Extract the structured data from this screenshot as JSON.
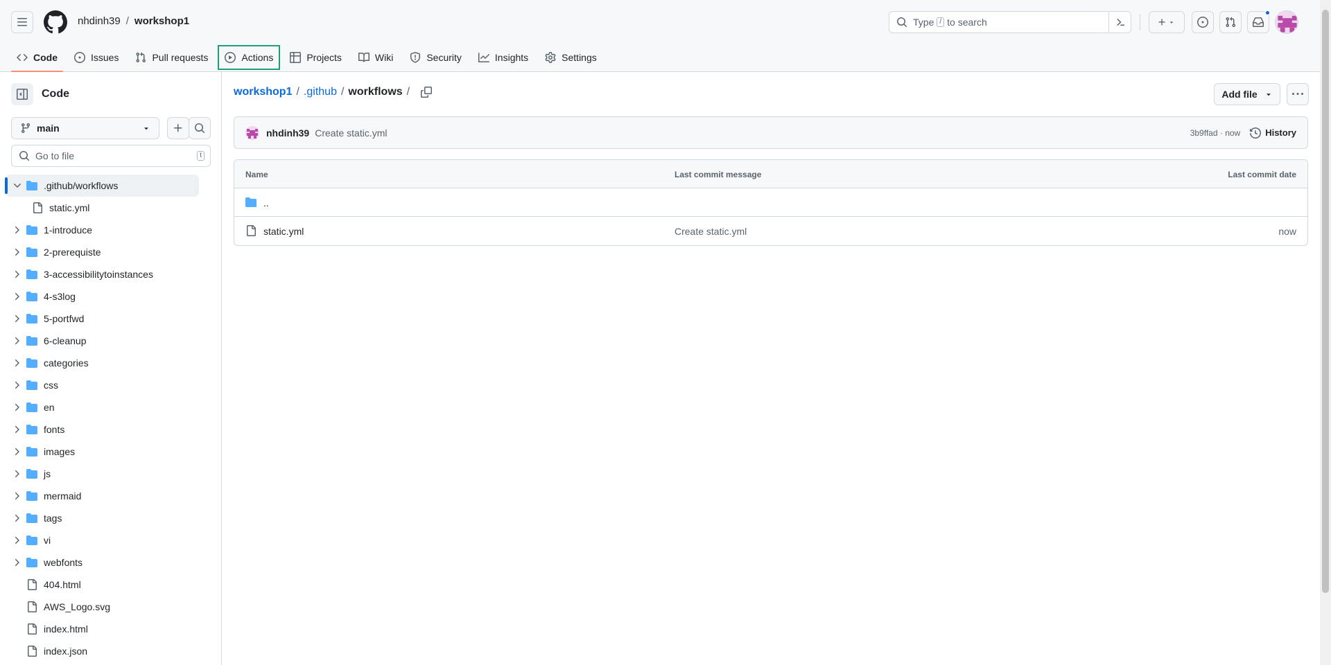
{
  "header": {
    "owner": "nhdinh39",
    "separator": "/",
    "repo": "workshop1",
    "search_prefix": "Type",
    "search_key": "/",
    "search_suffix": "to search",
    "create_label": "+"
  },
  "tabs": [
    {
      "label": "Code",
      "icon": "code-icon"
    },
    {
      "label": "Issues",
      "icon": "issue-opened-icon"
    },
    {
      "label": "Pull requests",
      "icon": "git-pull-request-icon"
    },
    {
      "label": "Actions",
      "icon": "play-icon"
    },
    {
      "label": "Projects",
      "icon": "table-icon"
    },
    {
      "label": "Wiki",
      "icon": "book-icon"
    },
    {
      "label": "Security",
      "icon": "shield-icon"
    },
    {
      "label": "Insights",
      "icon": "graph-icon"
    },
    {
      "label": "Settings",
      "icon": "gear-icon"
    }
  ],
  "sidebar": {
    "title": "Code",
    "branch": "main",
    "goto_placeholder": "Go to file",
    "goto_shortcut": "t",
    "tree": [
      {
        "label": ".github/workflows",
        "type": "folder",
        "expanded": true,
        "active": true
      },
      {
        "label": "static.yml",
        "type": "file",
        "child": true
      },
      {
        "label": "1-introduce",
        "type": "folder"
      },
      {
        "label": "2-prerequiste",
        "type": "folder"
      },
      {
        "label": "3-accessibilitytoinstances",
        "type": "folder"
      },
      {
        "label": "4-s3log",
        "type": "folder"
      },
      {
        "label": "5-portfwd",
        "type": "folder"
      },
      {
        "label": "6-cleanup",
        "type": "folder"
      },
      {
        "label": "categories",
        "type": "folder"
      },
      {
        "label": "css",
        "type": "folder"
      },
      {
        "label": "en",
        "type": "folder"
      },
      {
        "label": "fonts",
        "type": "folder"
      },
      {
        "label": "images",
        "type": "folder"
      },
      {
        "label": "js",
        "type": "folder"
      },
      {
        "label": "mermaid",
        "type": "folder"
      },
      {
        "label": "tags",
        "type": "folder"
      },
      {
        "label": "vi",
        "type": "folder"
      },
      {
        "label": "webfonts",
        "type": "folder"
      },
      {
        "label": "404.html",
        "type": "file"
      },
      {
        "label": "AWS_Logo.svg",
        "type": "file"
      },
      {
        "label": "index.html",
        "type": "file"
      },
      {
        "label": "index.json",
        "type": "file"
      }
    ]
  },
  "main": {
    "breadcrumb": {
      "repo": "workshop1",
      "sep": "/",
      "dir1": ".github",
      "current": "workflows",
      "trail": "/"
    },
    "add_file_label": "Add file",
    "commit": {
      "author": "nhdinh39",
      "message": "Create static.yml",
      "meta": "3b9ffad · now",
      "history_label": "History"
    },
    "table": {
      "headers": {
        "name": "Name",
        "message": "Last commit message",
        "date": "Last commit date"
      },
      "rows": [
        {
          "name": "..",
          "type": "folder",
          "message": "",
          "date": ""
        },
        {
          "name": "static.yml",
          "type": "file",
          "message": "Create static.yml",
          "date": "now"
        }
      ]
    }
  },
  "colors": {
    "link": "#0969da",
    "folder": "#54aeff",
    "selected_underline": "#fd8c73",
    "focus_ring": "#1f9e7d"
  }
}
